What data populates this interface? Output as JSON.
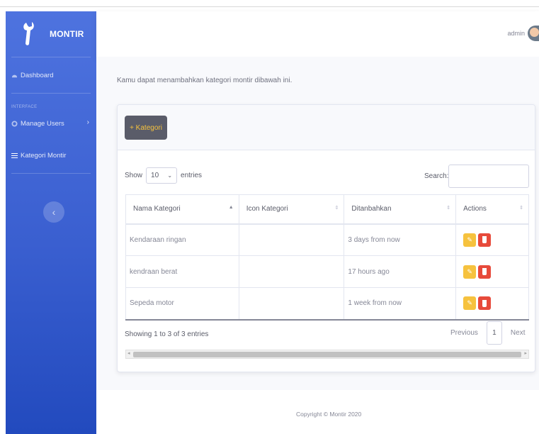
{
  "sidebar": {
    "brand": "MONTIR",
    "dashboard": "Dashboard",
    "heading": "INTERFACE",
    "manage_users": "Manage Users",
    "kategori": "Kategori Montir"
  },
  "topbar": {
    "user": "admin"
  },
  "main": {
    "intro": "Kamu dapat menambahkan kategori montir dibawah ini.",
    "add_button": "+ Kategori",
    "show_label": "Show",
    "entries_value": "10",
    "entries_label": "entries",
    "search_label": "Search:",
    "search_value": "",
    "columns": [
      "Nama Kategori",
      "Icon Kategori",
      "Ditanbahkan",
      "Actions"
    ],
    "rows": [
      {
        "nama": "Kendaraan ringan",
        "icon": "",
        "ditambahkan": "3 days from now"
      },
      {
        "nama": "kendraan berat",
        "icon": "",
        "ditambahkan": "17 hours ago"
      },
      {
        "nama": "Sepeda motor",
        "icon": "",
        "ditambahkan": "1 week from now"
      }
    ],
    "info": "Showing 1 to 3 of 3 entries",
    "previous": "Previous",
    "page": "1",
    "next": "Next"
  },
  "footer": "Copyright © Montir 2020",
  "colors": {
    "sidebar": "#4e73df",
    "edit": "#f6c23e",
    "delete": "#e74a3b",
    "button": "#5a5c69"
  }
}
